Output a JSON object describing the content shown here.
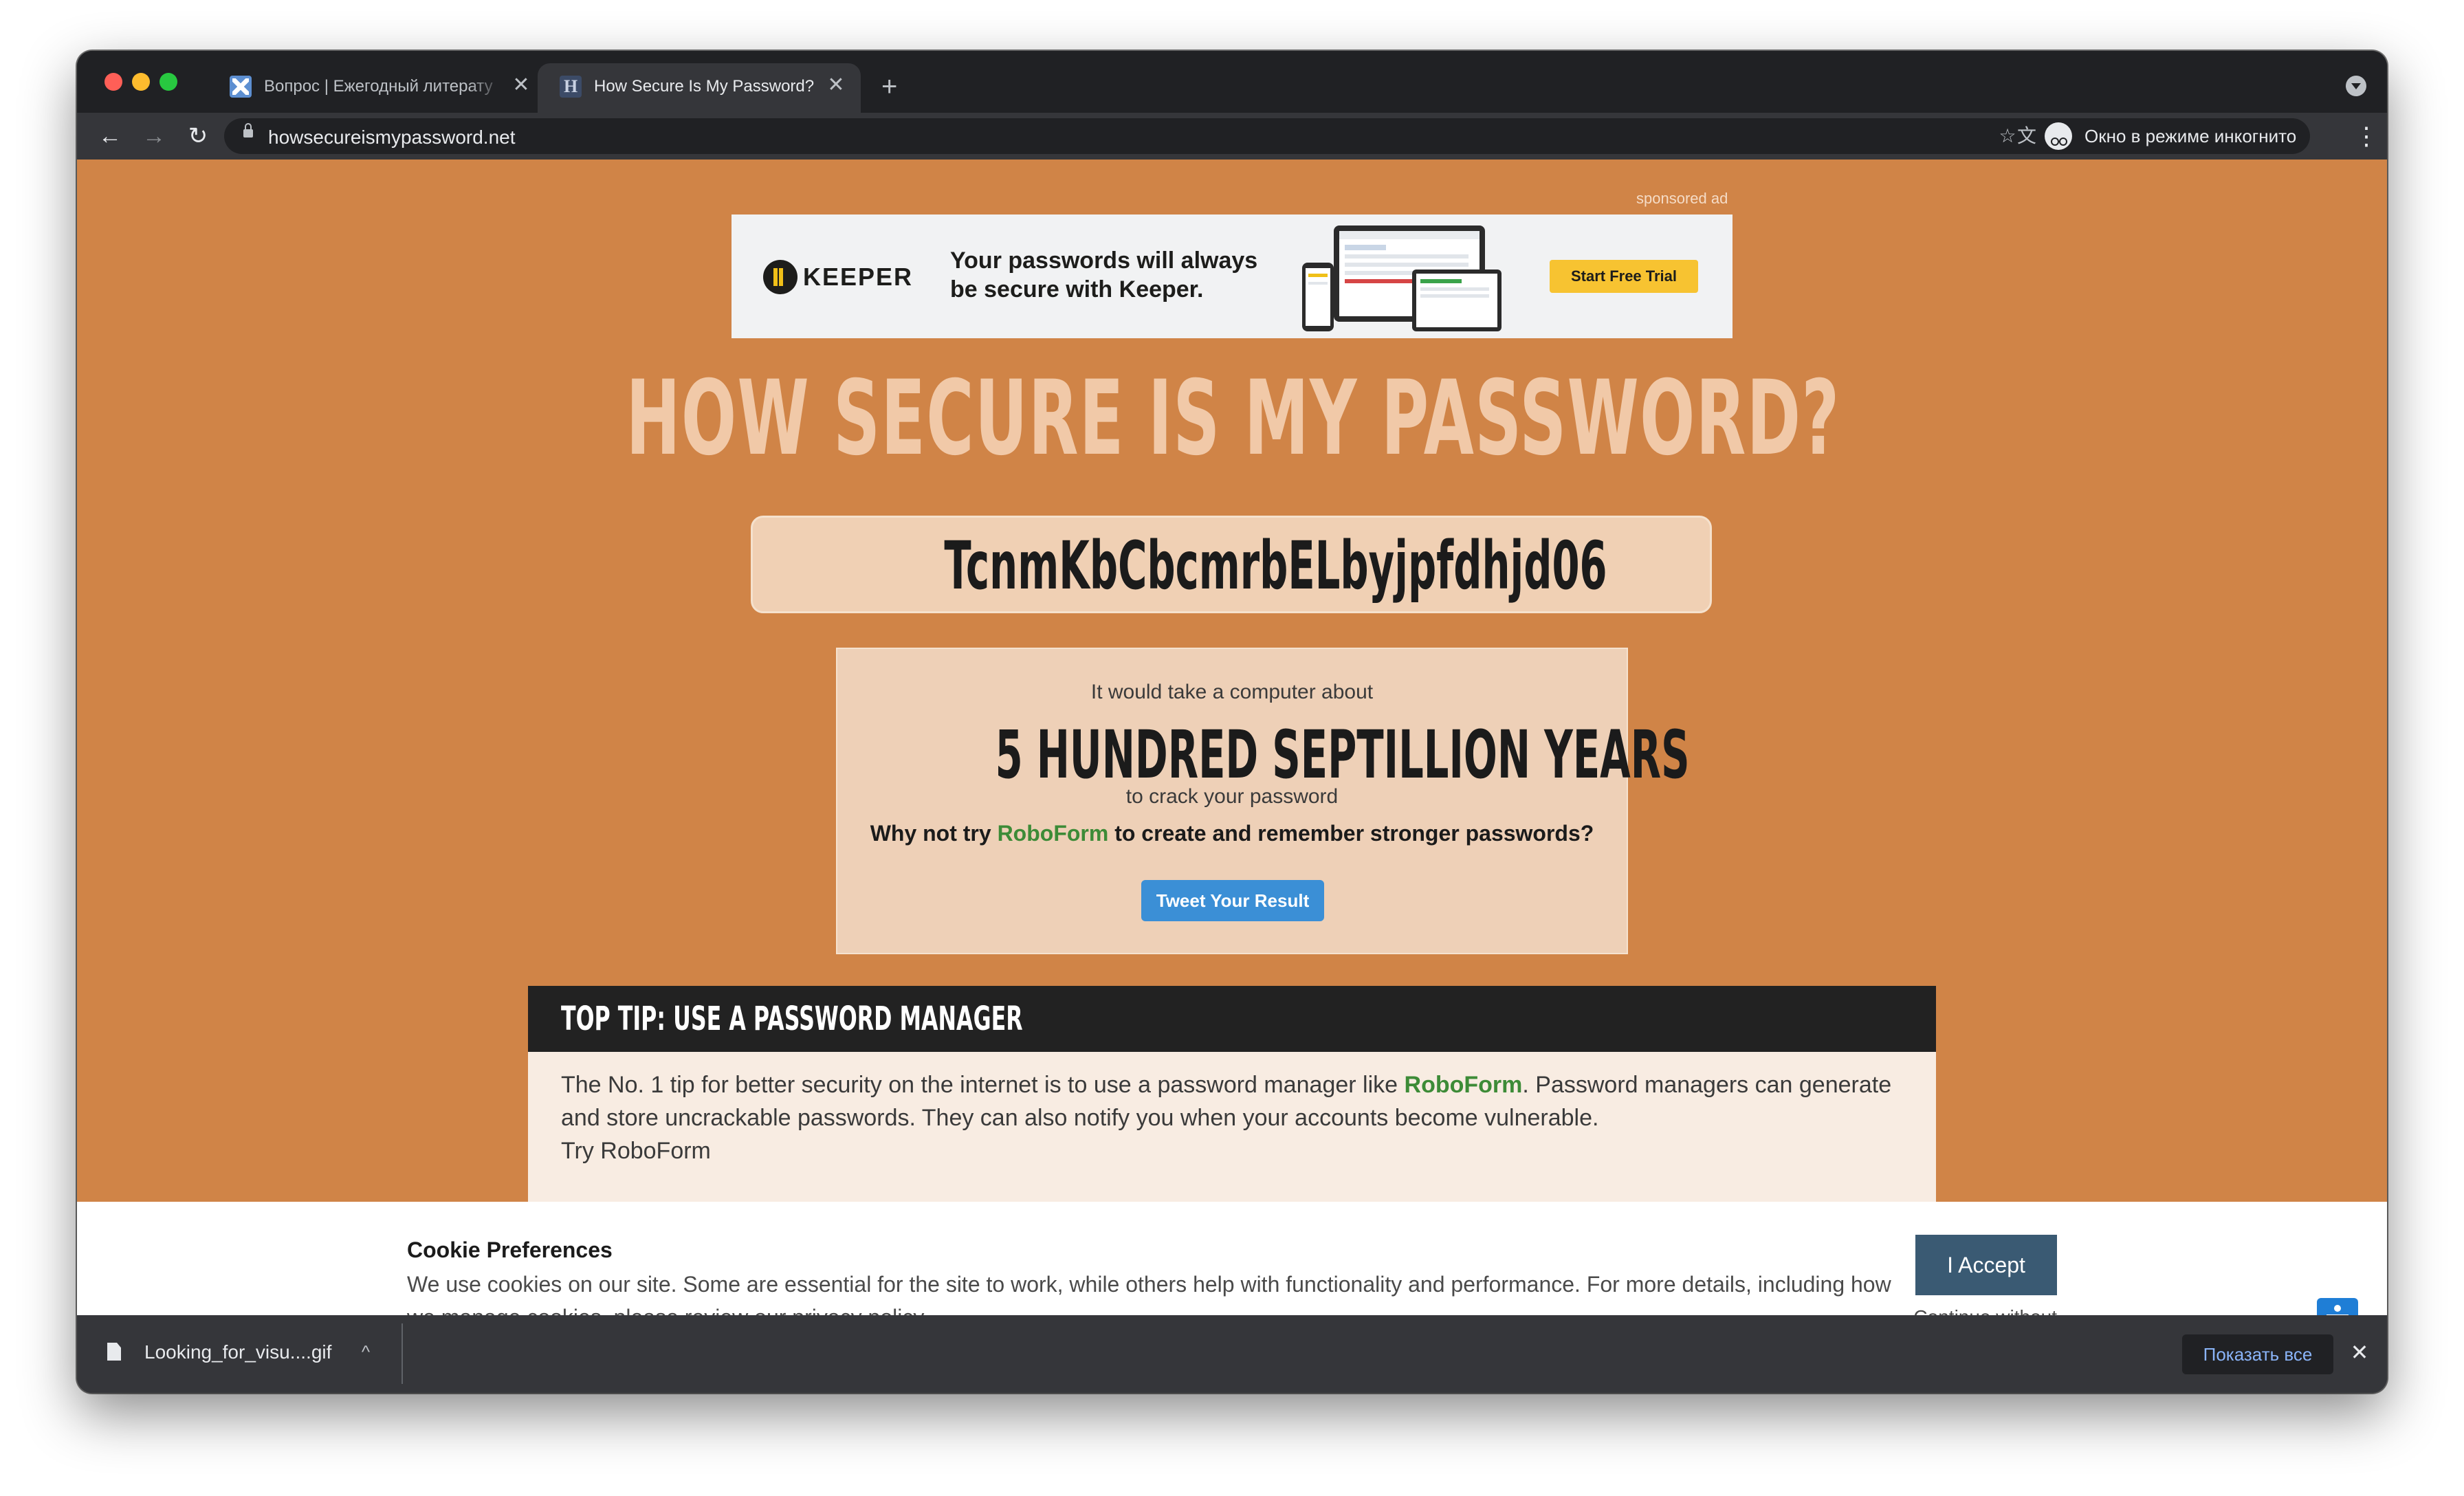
{
  "browser": {
    "tabs": [
      {
        "title": "Вопрос | Ежегодный литерату",
        "icon": "journal-favicon-icon"
      },
      {
        "title": "How Secure Is My Password?",
        "icon": "h-favicon-icon"
      }
    ],
    "close_glyph": "✕",
    "new_tab_glyph": "+",
    "back_glyph": "←",
    "forward_glyph": "→",
    "reload_glyph": "↻",
    "url": "howsecureismypassword.net",
    "translate_glyph": "文",
    "eye_glyph": "⊘",
    "star_glyph": "☆",
    "incognito_label": "Окно в режиме инкогнито",
    "menu_glyph": "⋮"
  },
  "page": {
    "sponsored_label": "sponsored ad",
    "ad": {
      "brand": "KEEPER",
      "text": "Your passwords will always be secure with Keeper.",
      "cta": "Start Free Trial"
    },
    "title": "HOW SECURE IS MY PASSWORD?",
    "password_value": "TcnmKbCbcmrbELbyjpfdhjd06",
    "result": {
      "pre": "It would take a computer about",
      "time": "5 HUNDRED SEPTILLION YEARS",
      "post": "to crack your password",
      "why_prefix": "Why not try ",
      "why_link": "RoboForm",
      "why_suffix": " to create and remember stronger passwords?",
      "tweet_button": "Tweet Your Result"
    },
    "tip": {
      "title": "TOP TIP: USE A PASSWORD MANAGER",
      "body_prefix": "The No. 1 tip for better security on the internet is to use a password manager like ",
      "body_link": "RoboForm",
      "body_suffix": ". Password managers can generate and store uncrackable passwords. They can also notify you when your accounts become vulnerable.",
      "body_more": "Try RoboForm"
    }
  },
  "cookie": {
    "title": "Cookie Preferences",
    "text_prefix": "We use cookies on our site. Some are essential for the site to work, while others help with functionality and performance. For more details, including how we manage cookies, please review our ",
    "link": "privacy policy",
    "text_suffix": ".",
    "accept": "I Accept",
    "continue": "Continue without accepting"
  },
  "downloads": {
    "file_name": "Looking_for_visu....gif",
    "chevron_glyph": "^",
    "show_all": "Показать все",
    "close_glyph": "✕"
  },
  "colors": {
    "page_background": "#d08447",
    "title": "#f1c9a8",
    "link_green": "#3d8b37",
    "tweet_button": "#3b8fd6",
    "accept_button": "#3a5a73",
    "ad_cta": "#f7c331"
  }
}
